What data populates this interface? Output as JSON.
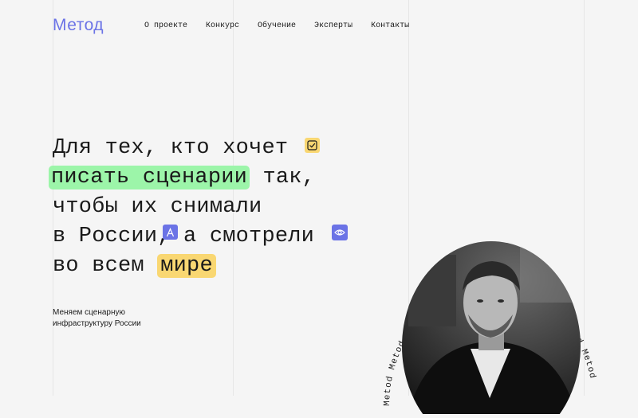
{
  "logo": "Метод",
  "nav": [
    "О проекте",
    "Конкурс",
    "Обучение",
    "Эксперты",
    "Контакты"
  ],
  "headline": {
    "line1": "Для тех, кто хочет",
    "line2_highlight": "писать сценарии",
    "line2_rest": " так,",
    "line3": "чтобы их снимали",
    "line4_a": "в России,",
    "line4_b": " а смотрели",
    "line5_a": "во всем ",
    "line5_highlight": "мире"
  },
  "subtitle_line1": "Меняем сценарную",
  "subtitle_line2": "инфраструктуру России",
  "ring_text": "Metod Metod Metod Metod Metod Metod Metod Metod Metod",
  "colors": {
    "accent": "#6b73e6",
    "green": "#9cf5a9",
    "yellow": "#f9d772"
  },
  "icons": [
    "checkbox-icon",
    "a-letter-icon",
    "eye-icon"
  ]
}
